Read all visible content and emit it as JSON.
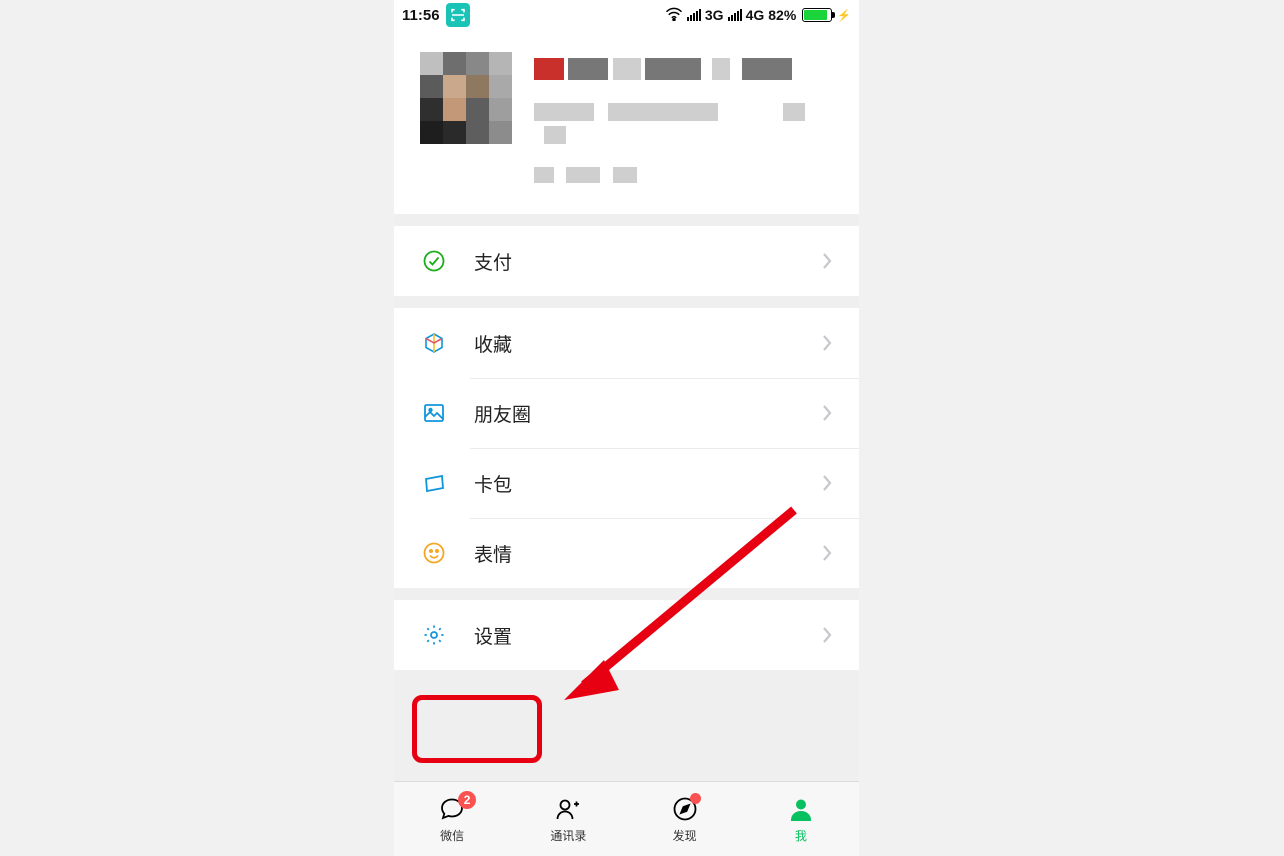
{
  "status": {
    "time": "11:56",
    "net1": "3G",
    "net2": "4G",
    "battery": "82%"
  },
  "menu": {
    "pay": "支付",
    "favorites": "收藏",
    "moments": "朋友圈",
    "cards": "卡包",
    "stickers": "表情",
    "settings": "设置"
  },
  "tabs": {
    "chats": "微信",
    "contacts": "通讯录",
    "discover": "发现",
    "me": "我",
    "chats_badge": "2"
  }
}
